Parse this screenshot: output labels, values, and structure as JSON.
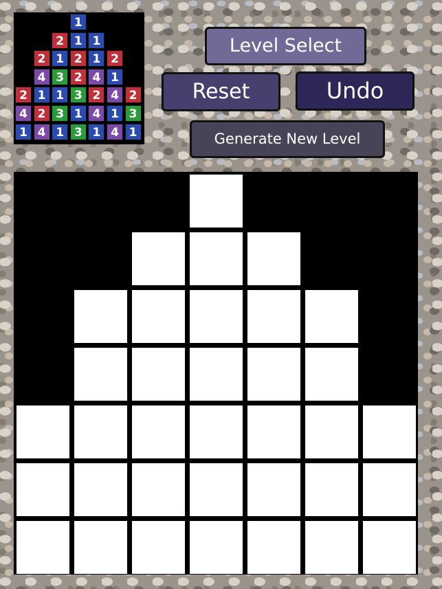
{
  "buttons": {
    "level_select": "Level Select",
    "reset": "Reset",
    "undo": "Undo",
    "generate": "Generate New Level"
  },
  "colors": {
    "1": "#2b4bb0",
    "2": "#c0303a",
    "3": "#2a9a3a",
    "4": "#7b4aa8",
    "board": "#000000",
    "empty_cell": "#ffffff"
  },
  "preview": {
    "rows": [
      [
        null,
        null,
        null,
        1,
        null,
        null,
        null
      ],
      [
        null,
        null,
        2,
        1,
        1,
        null,
        null
      ],
      [
        null,
        2,
        1,
        2,
        1,
        2,
        null
      ],
      [
        null,
        4,
        3,
        2,
        4,
        1,
        null
      ],
      [
        2,
        1,
        1,
        3,
        2,
        4,
        2
      ],
      [
        4,
        2,
        3,
        1,
        4,
        1,
        3
      ],
      [
        1,
        4,
        1,
        3,
        1,
        4,
        1
      ]
    ]
  }
}
